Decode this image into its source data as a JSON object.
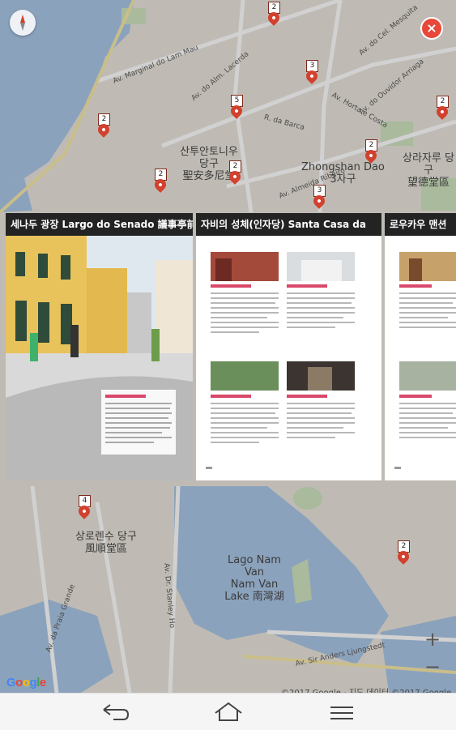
{
  "map": {
    "districts": [
      {
        "name": "Zhongshan Dao",
        "sub": "3자구"
      },
      {
        "name": "산투안토니우 당구",
        "sub": "聖安多尼堂"
      },
      {
        "name": "상라자루 당구",
        "sub": "望德堂區"
      },
      {
        "name": "상로렌수 당구",
        "sub": "風順堂區"
      },
      {
        "name": "Lago Nam Van",
        "sub": "Nam Van Lake 南灣湖"
      }
    ],
    "streets": [
      "Av. Marginal do Lam Mau",
      "Av. do Alm. Lacerda",
      "Av. do Cel. Mesquita",
      "Av. do Ouvidor Arriaga",
      "Av. Horta e Costa",
      "R. da Barca",
      "Av. Almeida Ribeiro",
      "Av. Dr. Stanley Ho",
      "Av. da Praia Grande",
      "Av. Sir Anders Ljungstedt"
    ],
    "pins": [
      "2",
      "2",
      "3",
      "5",
      "2",
      "2",
      "2",
      "2",
      "3",
      "4",
      "2"
    ],
    "attribution": "©2017 Google - 지도 데이터 ©2017 Google",
    "logo": "Google"
  },
  "controls": {
    "compass": "compass-icon",
    "close": "×",
    "zoom_in": "+",
    "zoom_out": "−"
  },
  "cards": [
    {
      "title": "세나두 광장 Largo do Senado 議事亭前",
      "type": "photo"
    },
    {
      "title": "자비의 성체(인자당) Santa Casa da",
      "type": "page"
    },
    {
      "title": "로우카우 맨션",
      "type": "page"
    }
  ],
  "navbar": {
    "back": "back-icon",
    "home": "home-icon",
    "recents": "recent-apps-icon"
  }
}
